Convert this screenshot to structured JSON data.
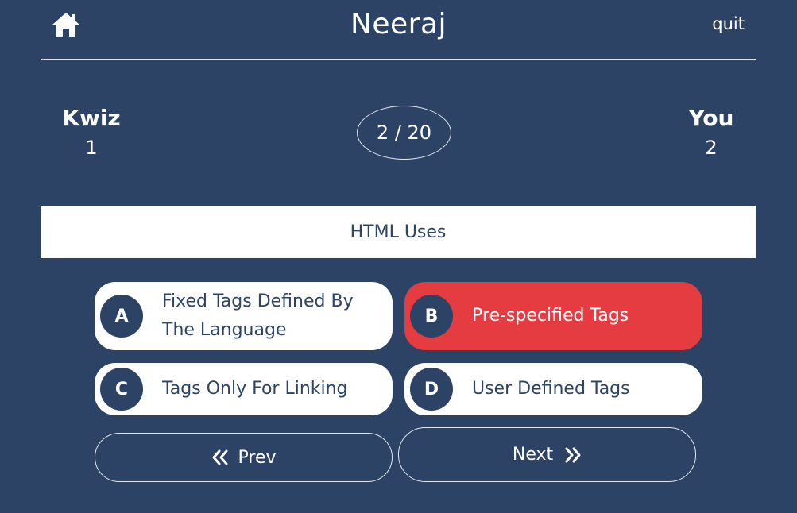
{
  "header": {
    "title": "Neeraj",
    "quit_label": "quit",
    "home_icon": "home-icon"
  },
  "scoreboard": {
    "left_player": {
      "name": "Kwiz",
      "score": "1"
    },
    "right_player": {
      "name": "You",
      "score": "2"
    },
    "progress": "2 / 20"
  },
  "question": {
    "text": "HTML Uses"
  },
  "options": [
    {
      "letter": "A",
      "text": "Fixed Tags Defined By The Language",
      "selected": false
    },
    {
      "letter": "B",
      "text": "Pre-specified Tags",
      "selected": true
    },
    {
      "letter": "C",
      "text": "Tags Only For Linking",
      "selected": false
    },
    {
      "letter": "D",
      "text": "User Defined Tags",
      "selected": false
    }
  ],
  "navigation": {
    "prev_label": "Prev",
    "next_label": "Next",
    "prev_icon": "double-chevron-left-icon",
    "next_icon": "double-chevron-right-icon"
  },
  "colors": {
    "background": "#2c4366",
    "selected": "#e43c40",
    "surface": "#ffffff"
  }
}
